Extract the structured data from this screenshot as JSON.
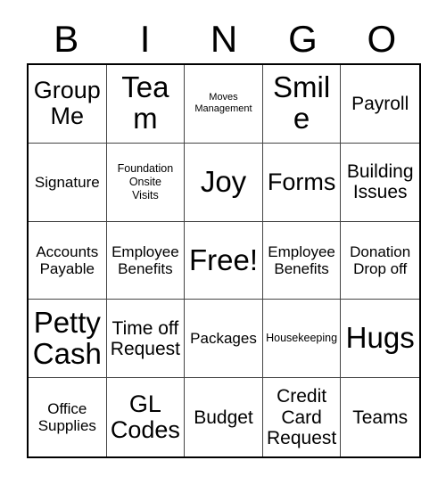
{
  "card": {
    "title": "BINGO",
    "header_letters": [
      "B",
      "I",
      "N",
      "G",
      "O"
    ],
    "grid_size": "5x5",
    "colors": {
      "background": "#ffffff",
      "text": "#000000",
      "outer_border": "#000000",
      "inner_border": "#444444"
    },
    "rows": [
      [
        {
          "text": "Group\nMe",
          "size": "xl"
        },
        {
          "text": "Team",
          "size": "xxl"
        },
        {
          "text": "Moves\nManagement",
          "size": "xs"
        },
        {
          "text": "Smile",
          "size": "xxl"
        },
        {
          "text": "Payroll",
          "size": "lg"
        }
      ],
      [
        {
          "text": "Signature",
          "size": "md"
        },
        {
          "text": "Foundation\nOnsite\nVisits",
          "size": "sm"
        },
        {
          "text": "Joy",
          "size": "xxl"
        },
        {
          "text": "Forms",
          "size": "xl"
        },
        {
          "text": "Building\nIssues",
          "size": "lg"
        }
      ],
      [
        {
          "text": "Accounts\nPayable",
          "size": "md"
        },
        {
          "text": "Employee\nBenefits",
          "size": "md"
        },
        {
          "text": "Free!",
          "size": "xxl"
        },
        {
          "text": "Employee\nBenefits",
          "size": "md"
        },
        {
          "text": "Donation\nDrop off",
          "size": "md"
        }
      ],
      [
        {
          "text": "Petty\nCash",
          "size": "xxl"
        },
        {
          "text": "Time off\nRequest",
          "size": "lg"
        },
        {
          "text": "Packages",
          "size": "md"
        },
        {
          "text": "Housekeeping",
          "size": "sm"
        },
        {
          "text": "Hugs",
          "size": "xxl"
        }
      ],
      [
        {
          "text": "Office\nSupplies",
          "size": "md"
        },
        {
          "text": "GL\nCodes",
          "size": "xl"
        },
        {
          "text": "Budget",
          "size": "lg"
        },
        {
          "text": "Credit\nCard\nRequest",
          "size": "lg"
        },
        {
          "text": "Teams",
          "size": "lg"
        }
      ]
    ]
  }
}
